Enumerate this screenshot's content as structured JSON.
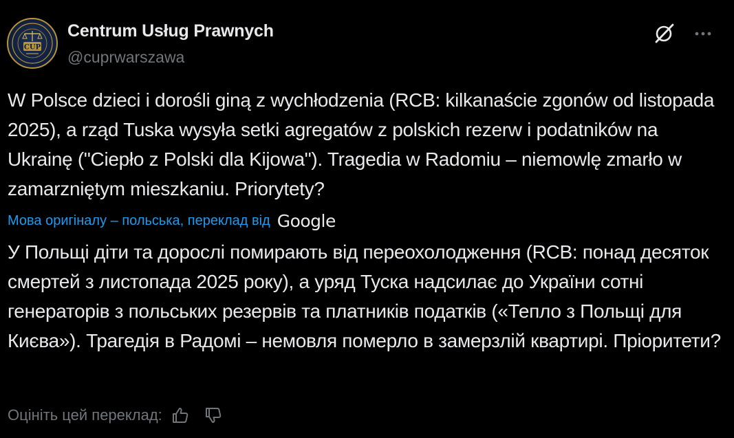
{
  "author": {
    "display_name": "Centrum Usług Prawnych",
    "handle": "@cuprwarszawa",
    "avatar_text": "CUP",
    "avatar_icon": "cup-logo-avatar"
  },
  "header_actions": {
    "grok_icon": "grok-icon",
    "more_icon": "more-icon"
  },
  "post": {
    "text": "W Polsce dzieci i dorośli giną z wychłodzenia (RCB: kilkanaście zgonów od listopada 2025), a rząd Tuska wysyła setki agregatów z polskich rezerw i podatników na Ukrainę (\"Ciepło z Polski dla Kijowa\"). Tragedia w Radomiu – niemowlę zmarło w zamarzniętym mieszkaniu. Priorytety?"
  },
  "translation": {
    "notice": "Мова оригіналу – польська, переклад від",
    "provider": "Google",
    "text": "У Польщі діти та дорослі помирають від переохолодження (RCB: понад десяток смертей з листопада 2025 року), а уряд Туска надсилає до України сотні генераторів з польських резервів та платників податків («Тепло з Польщі для Києва»). Трагедія в Радомі – немовля померло в замерзлій квартирі. Пріоритети?"
  },
  "rating": {
    "label": "Оцініть цей переклад:",
    "thumbs_up_icon": "thumbs-up-icon",
    "thumbs_down_icon": "thumbs-down-icon"
  },
  "colors": {
    "background": "#000000",
    "text_primary": "#e7e9ea",
    "text_secondary": "#71767b",
    "link": "#1d9bf0"
  }
}
